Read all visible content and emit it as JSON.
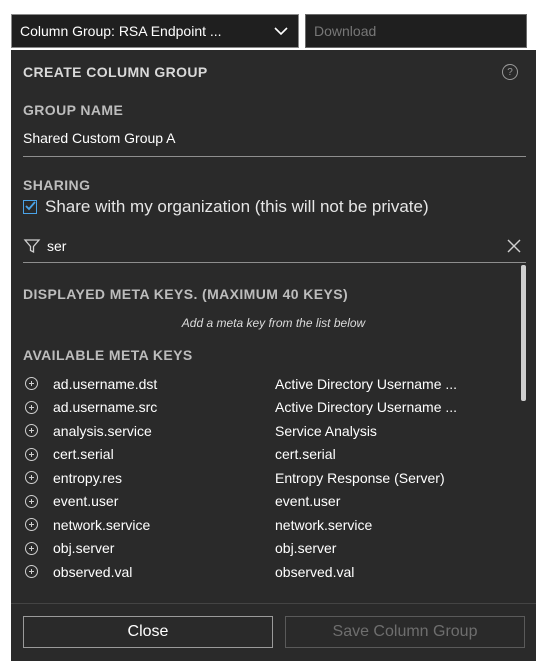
{
  "topbar": {
    "column_group_select": "Column Group: RSA Endpoint ...",
    "download_placeholder": "Download"
  },
  "panel": {
    "title": "CREATE COLUMN GROUP",
    "group_name_label": "GROUP NAME",
    "group_name_value": "Shared Custom Group A",
    "sharing_label": "SHARING",
    "share_checkbox_label": "Share with my organization (this will not be private)",
    "share_checked": true,
    "filter_value": "ser",
    "displayed_label": "DISPLAYED META KEYS. (MAXIMUM 40 KEYS)",
    "displayed_hint": "Add a meta key from the list below",
    "available_label": "AVAILABLE META KEYS",
    "available_keys": [
      {
        "key": "ad.username.dst",
        "desc": "Active Directory Username ..."
      },
      {
        "key": "ad.username.src",
        "desc": "Active Directory Username ..."
      },
      {
        "key": "analysis.service",
        "desc": "Service Analysis"
      },
      {
        "key": "cert.serial",
        "desc": "cert.serial"
      },
      {
        "key": "entropy.res",
        "desc": "Entropy Response (Server)"
      },
      {
        "key": "event.user",
        "desc": "event.user"
      },
      {
        "key": "network.service",
        "desc": "network.service"
      },
      {
        "key": "obj.server",
        "desc": "obj.server"
      },
      {
        "key": "observed.val",
        "desc": "observed.val"
      }
    ]
  },
  "footer": {
    "close_label": "Close",
    "save_label": "Save Column Group"
  },
  "colors": {
    "panel_bg": "#2a2a2a",
    "accent": "#4aa3e8"
  }
}
